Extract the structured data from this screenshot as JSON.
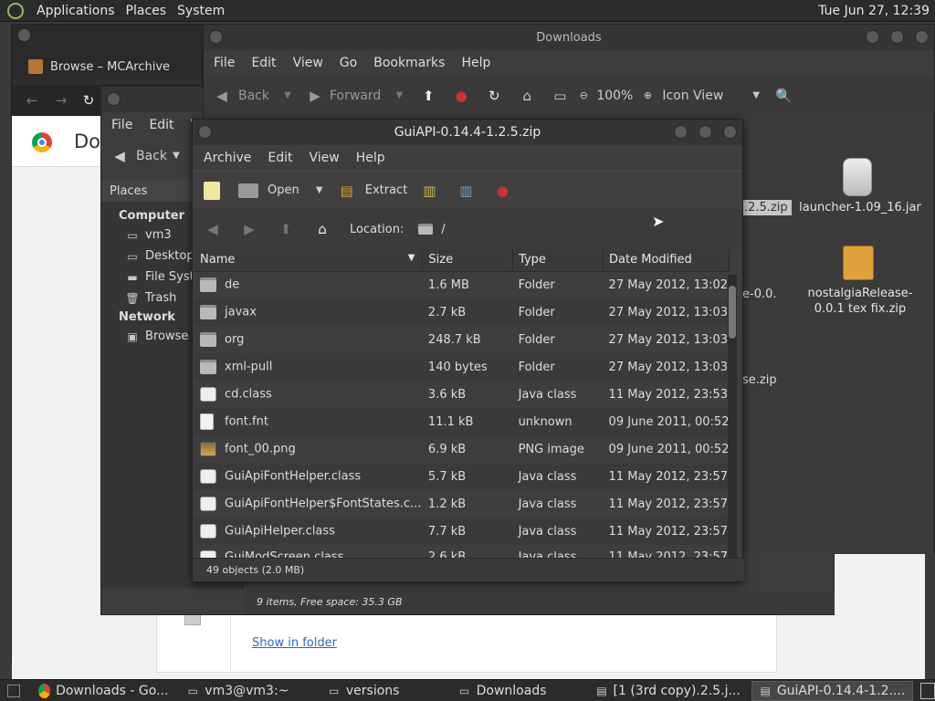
{
  "topbar": {
    "menus": [
      "Applications",
      "Places",
      "System"
    ],
    "clock": "Tue Jun 27, 12:39"
  },
  "chrome": {
    "tab_title": "Browse – MCArchive",
    "page_heading": "Dov",
    "show_in_folder": "Show in folder"
  },
  "files_back": {
    "menus": [
      "File",
      "Edit",
      "V"
    ],
    "back_label": "Back",
    "places_label": "Places",
    "computer_header": "Computer",
    "computer_items": [
      "vm3",
      "Desktop",
      "File Syst",
      "Trash"
    ],
    "network_header": "Network",
    "network_items": [
      "Browse I"
    ],
    "status": "9 items, Free space: 35.3 GB"
  },
  "downloads": {
    "title": "Downloads",
    "menus": [
      "File",
      "Edit",
      "View",
      "Go",
      "Bookmarks",
      "Help"
    ],
    "back_label": "Back",
    "forward_label": "Forward",
    "zoom": "100%",
    "view_mode": "Icon View",
    "selected_partial": ".2.5.zip",
    "partial_1": "e-0.0.",
    "partial_2": "se.zip",
    "icon_1": "launcher-1.09_16.jar",
    "icon_2": "nostalgiaRelease-0.0.1 tex fix.zip"
  },
  "archive": {
    "title": "GuiAPI-0.14.4-1.2.5.zip",
    "menus": [
      "Archive",
      "Edit",
      "View",
      "Help"
    ],
    "open_label": "Open",
    "extract_label": "Extract",
    "location_label": "Location:",
    "location_value": "/",
    "columns": [
      "Name",
      "Size",
      "Type",
      "Date Modified"
    ],
    "rows": [
      {
        "icon": "folder",
        "name": "de",
        "size": "1.6 MB",
        "type": "Folder",
        "date": "27 May 2012, 13:02"
      },
      {
        "icon": "folder",
        "name": "javax",
        "size": "2.7 kB",
        "type": "Folder",
        "date": "27 May 2012, 13:03"
      },
      {
        "icon": "folder",
        "name": "org",
        "size": "248.7 kB",
        "type": "Folder",
        "date": "27 May 2012, 13:03"
      },
      {
        "icon": "folder",
        "name": "xml-pull",
        "size": "140 bytes",
        "type": "Folder",
        "date": "27 May 2012, 13:03"
      },
      {
        "icon": "class",
        "name": "cd.class",
        "size": "3.6 kB",
        "type": "Java class",
        "date": "11 May 2012, 23:53"
      },
      {
        "icon": "text",
        "name": "font.fnt",
        "size": "11.1 kB",
        "type": "unknown",
        "date": "09 June 2011, 00:52"
      },
      {
        "icon": "png",
        "name": "font_00.png",
        "size": "6.9 kB",
        "type": "PNG image",
        "date": "09 June 2011, 00:52"
      },
      {
        "icon": "class",
        "name": "GuiApiFontHelper.class",
        "size": "5.7 kB",
        "type": "Java class",
        "date": "11 May 2012, 23:57"
      },
      {
        "icon": "class",
        "name": "GuiApiFontHelper$FontStates.c...",
        "size": "1.2 kB",
        "type": "Java class",
        "date": "11 May 2012, 23:57"
      },
      {
        "icon": "class",
        "name": "GuiApiHelper.class",
        "size": "7.7 kB",
        "type": "Java class",
        "date": "11 May 2012, 23:57"
      },
      {
        "icon": "class",
        "name": "GuiModScreen.class",
        "size": "2.6 kB",
        "type": "Java class",
        "date": "11 May 2012, 23:57"
      }
    ],
    "status": "49 objects (2.0 MB)"
  },
  "taskbar": {
    "tasks": [
      "Downloads - Go...",
      "vm3@vm3:~",
      "versions",
      "Downloads",
      "[1 (3rd copy).2.5.j...",
      "GuiAPI-0.14.4-1.2...."
    ]
  },
  "colors": {
    "accent": "#8fbf5a",
    "link": "#2a6ab8"
  }
}
